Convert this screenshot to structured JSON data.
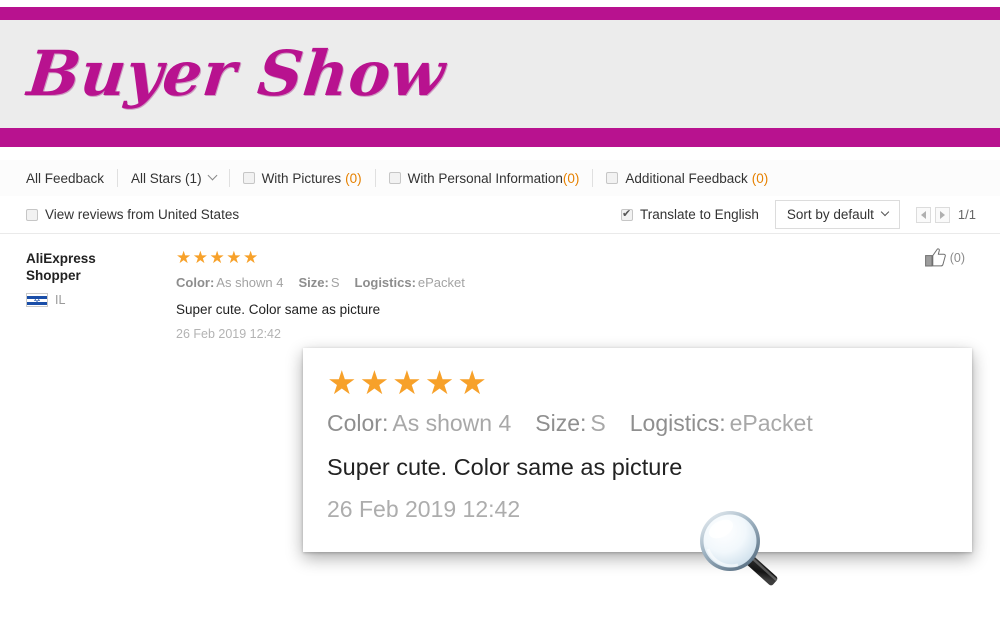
{
  "banner": {
    "title": "Buyer Show",
    "accent_color": "#b8128f",
    "background_color": "#ececec"
  },
  "filters": {
    "all_feedback": "All Feedback",
    "all_stars": "All Stars (1)",
    "with_pictures_label": "With Pictures",
    "with_pictures_count": "(0)",
    "with_personal_info_label": "With Personal Information",
    "with_personal_info_count": "(0)",
    "additional_feedback_label": "Additional Feedback",
    "additional_feedback_count": "(0)",
    "count_color": "#e68100"
  },
  "toolbar": {
    "view_reviews_label": "View reviews from United States",
    "translate_label": "Translate to English",
    "translate_checked": true,
    "sort_label": "Sort by default",
    "page_indicator": "1/1"
  },
  "review": {
    "user_name_line1": "AliExpress",
    "user_name_line2": "Shopper",
    "country_code": "IL",
    "flag_symbol": "✡",
    "rating": 5,
    "stars_glyphs": "★★★★★",
    "color_label": "Color:",
    "color_value": "As shown 4",
    "size_label": "Size:",
    "size_value": "S",
    "logistics_label": "Logistics:",
    "logistics_value": "ePacket",
    "text": "Super cute. Color same as picture",
    "date": "26 Feb 2019 12:42",
    "helpful_count": "(0)",
    "star_color": "#f7a12a"
  },
  "zoom_card": {
    "stars_glyphs": "★★★★★",
    "color_label": "Color:",
    "color_value": "As shown 4",
    "size_label": "Size:",
    "size_value": "S",
    "logistics_label": "Logistics:",
    "logistics_value": "ePacket",
    "text": "Super cute. Color same as picture",
    "date": "26 Feb 2019 12:42"
  }
}
